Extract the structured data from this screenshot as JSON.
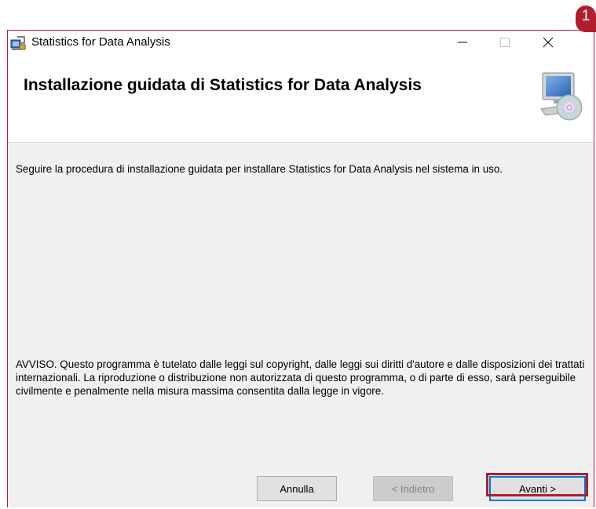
{
  "annotation": {
    "badge_number": "1",
    "accent_color": "#b01e2e"
  },
  "window": {
    "title": "Statistics for Data Analysis",
    "controls": {
      "minimize": "minimize-icon",
      "maximize": "maximize-icon",
      "close": "close-icon"
    }
  },
  "header": {
    "title": "Installazione guidata di Statistics for Data Analysis",
    "icon": "computer-cd-icon"
  },
  "content": {
    "intro": "Seguire la procedura di installazione guidata per installare Statistics for Data Analysis nel sistema in uso.",
    "notice": "AVVISO. Questo programma è tutelato dalle leggi sul copyright, dalle leggi sui diritti d'autore e dalle disposizioni dei trattati internazionali. La riproduzione o distribuzione non autorizzata di questo programma, o di parte di esso, sarà perseguibile civilmente e penalmente nella misura massima consentita dalla legge in vigore."
  },
  "buttons": {
    "cancel": "Annulla",
    "back": "< Indietro",
    "next": "Avanti >"
  }
}
